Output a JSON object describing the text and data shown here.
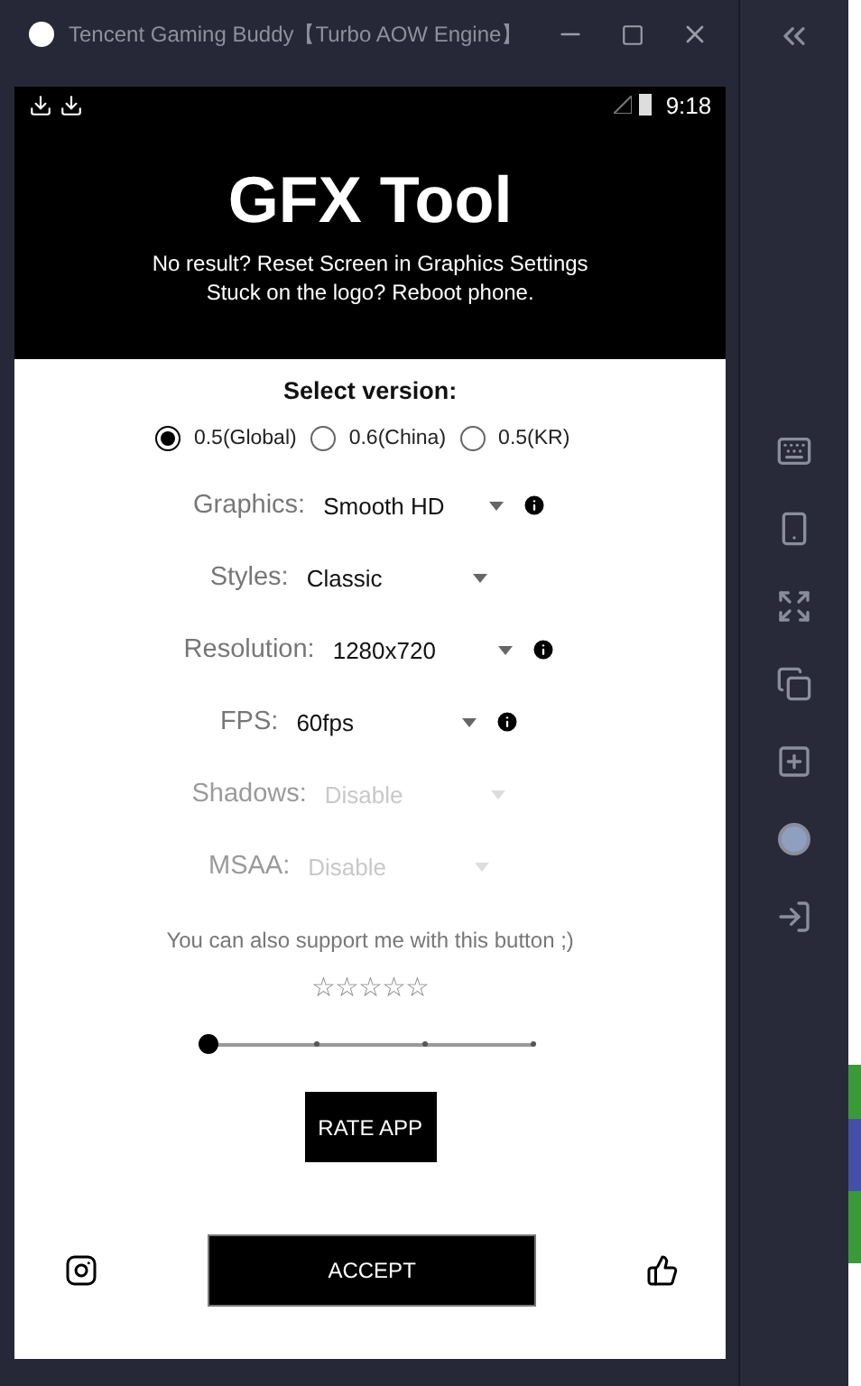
{
  "window": {
    "title": "Tencent Gaming Buddy【Turbo AOW Engine】"
  },
  "status_bar": {
    "time": "9:18"
  },
  "header": {
    "title": "GFX Tool",
    "lines": [
      "No result? Reset Screen in Graphics Settings",
      "Stuck on the logo? Reboot phone."
    ]
  },
  "version": {
    "label": "Select version:",
    "options": [
      {
        "label": "0.5(Global)",
        "selected": true
      },
      {
        "label": "0.6(China)",
        "selected": false
      },
      {
        "label": "0.5(KR)",
        "selected": false
      }
    ]
  },
  "settings": [
    {
      "label": "Graphics:",
      "value": "Smooth HD",
      "info": true,
      "disabled": false
    },
    {
      "label": "Styles:",
      "value": "Classic",
      "info": false,
      "disabled": false
    },
    {
      "label": "Resolution:",
      "value": "1280x720",
      "info": true,
      "disabled": false
    },
    {
      "label": "FPS:",
      "value": "60fps",
      "info": true,
      "disabled": false
    },
    {
      "label": "Shadows:",
      "value": "Disable",
      "info": false,
      "disabled": true
    },
    {
      "label": "MSAA:",
      "value": "Disable",
      "info": false,
      "disabled": true
    }
  ],
  "support": {
    "text": "You can also support me with this button ;)",
    "stars": 0,
    "slider": {
      "level": 0
    },
    "button": "RATE APP"
  },
  "footer": {
    "button": "ACCEPT"
  }
}
